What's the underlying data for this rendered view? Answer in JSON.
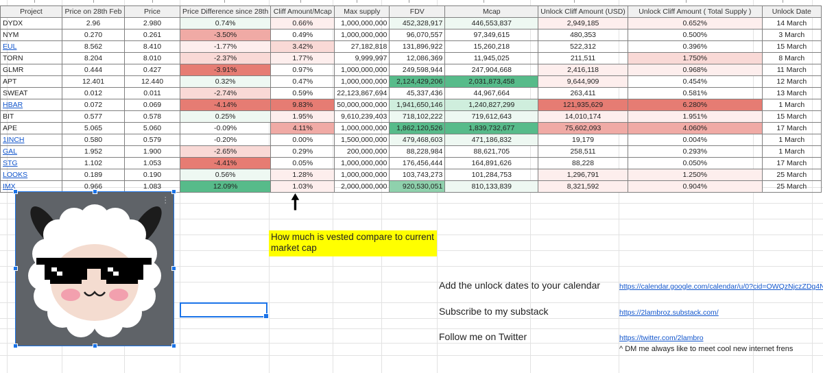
{
  "headers": [
    "Project",
    "Price on 28th Feb",
    "Price",
    "Price Difference since 28th",
    "Cliff Amount/Mcap",
    "Max supply",
    "FDV",
    "Mcap",
    "Unlock Cliff Amount (USD)",
    "Unlock Cliff Amount ( Total Supply )",
    "Unlock Date"
  ],
  "rows": [
    [
      "DYDX",
      "2.96",
      "2.980",
      "0.74%",
      "0.66%",
      "1,000,000,000",
      "452,328,917",
      "446,553,837",
      "2,949,185",
      "0.652%",
      "14 March"
    ],
    [
      "NYM",
      "0.270",
      "0.261",
      "-3.50%",
      "0.49%",
      "1,000,000,000",
      "96,070,557",
      "97,349,615",
      "480,353",
      "0.500%",
      "3 March"
    ],
    [
      "EUL",
      "8.562",
      "8.410",
      "-1.77%",
      "3.42%",
      "27,182,818",
      "131,896,922",
      "15,260,218",
      "522,312",
      "0.396%",
      "15 March"
    ],
    [
      "TORN",
      "8.204",
      "8.010",
      "-2.37%",
      "1.77%",
      "9,999,997",
      "12,086,369",
      "11,945,025",
      "211,511",
      "1.750%",
      "8 March"
    ],
    [
      "GLMR",
      "0.444",
      "0.427",
      "-3.91%",
      "0.97%",
      "1,000,000,000",
      "249,598,944",
      "247,904,668",
      "2,416,118",
      "0.968%",
      "11 March"
    ],
    [
      "APT",
      "12.401",
      "12.440",
      "0.32%",
      "0.47%",
      "1,000,000,000",
      "2,124,429,206",
      "2,031,873,458",
      "9,644,909",
      "0.454%",
      "12 March"
    ],
    [
      "SWEAT",
      "0.012",
      "0.011",
      "-2.74%",
      "0.59%",
      "22,123,867,694",
      "45,337,436",
      "44,967,664",
      "263,411",
      "0.581%",
      "13 March"
    ],
    [
      "HBAR",
      "0.072",
      "0.069",
      "-4.14%",
      "9.83%",
      "50,000,000,000",
      "1,941,650,146",
      "1,240,827,299",
      "121,935,629",
      "6.280%",
      "1 March"
    ],
    [
      "BIT",
      "0.577",
      "0.578",
      "0.25%",
      "1.95%",
      "9,610,239,403",
      "718,102,222",
      "719,612,643",
      "14,010,174",
      "1.951%",
      "15 March"
    ],
    [
      "APE",
      "5.065",
      "5.060",
      "-0.09%",
      "4.11%",
      "1,000,000,000",
      "1,862,120,526",
      "1,839,732,677",
      "75,602,093",
      "4.060%",
      "17 March"
    ],
    [
      "1INCH",
      "0.580",
      "0.579",
      "-0.20%",
      "0.00%",
      "1,500,000,000",
      "479,468,603",
      "471,186,832",
      "19,179",
      "0.004%",
      "1 March"
    ],
    [
      "GAL",
      "1.952",
      "1.900",
      "-2.65%",
      "0.29%",
      "200,000,000",
      "88,228,984",
      "88,621,705",
      "258,511",
      "0.293%",
      "1 March"
    ],
    [
      "STG",
      "1.102",
      "1.053",
      "-4.41%",
      "0.05%",
      "1,000,000,000",
      "176,456,444",
      "164,891,626",
      "88,228",
      "0.050%",
      "17 March"
    ],
    [
      "LOOKS",
      "0.189",
      "0.190",
      "0.56%",
      "1.28%",
      "1,000,000,000",
      "103,743,273",
      "101,284,753",
      "1,296,791",
      "1.250%",
      "25 March"
    ],
    [
      "IMX",
      "0.966",
      "1.083",
      "12.09%",
      "1.03%",
      "2,000,000,000",
      "920,530,051",
      "810,133,839",
      "8,321,592",
      "0.904%",
      "25 March"
    ]
  ],
  "linked_projects": [
    "EUL",
    "HBAR",
    "1INCH",
    "GAL",
    "STG",
    "LOOKS",
    "IMX"
  ],
  "colors": {
    "red_strong": "#e67c73",
    "red_mid": "#f0aaa5",
    "red_light": "#f9d9d6",
    "red_faint": "#fdeeed",
    "green_strong": "#57bb8a",
    "green_mid": "#8fd1ad",
    "green_light": "#cfeedd",
    "green_faint": "#eef8f2",
    "white": "#ffffff"
  },
  "cell_colors": [
    [
      "",
      "",
      "",
      "green_faint",
      "red_faint",
      "",
      "green_faint",
      "green_faint",
      "red_faint",
      "red_faint",
      ""
    ],
    [
      "",
      "",
      "",
      "red_mid",
      "",
      "",
      "",
      "",
      "",
      "",
      ""
    ],
    [
      "",
      "",
      "",
      "red_faint",
      "red_light",
      "",
      "",
      "",
      "",
      "",
      ""
    ],
    [
      "",
      "",
      "",
      "red_light",
      "red_faint",
      "",
      "",
      "",
      "",
      "red_light",
      ""
    ],
    [
      "",
      "",
      "",
      "red_strong",
      "",
      "",
      "",
      "",
      "red_faint",
      "red_faint",
      ""
    ],
    [
      "",
      "",
      "",
      "green_faint",
      "",
      "",
      "green_strong",
      "green_strong",
      "red_faint",
      "",
      ""
    ],
    [
      "",
      "",
      "",
      "red_light",
      "",
      "",
      "",
      "",
      "",
      "",
      ""
    ],
    [
      "",
      "",
      "",
      "red_strong",
      "red_strong",
      "",
      "green_light",
      "green_light",
      "red_strong",
      "red_strong",
      ""
    ],
    [
      "",
      "",
      "",
      "green_faint",
      "red_faint",
      "",
      "green_faint",
      "green_faint",
      "red_faint",
      "red_faint",
      ""
    ],
    [
      "",
      "",
      "",
      "",
      "red_mid",
      "",
      "green_strong",
      "green_strong",
      "red_mid",
      "red_mid",
      ""
    ],
    [
      "",
      "",
      "",
      "",
      "",
      "",
      "green_faint",
      "green_faint",
      "",
      "",
      ""
    ],
    [
      "",
      "",
      "",
      "red_light",
      "",
      "",
      "",
      "",
      "",
      "",
      ""
    ],
    [
      "",
      "",
      "",
      "red_strong",
      "",
      "",
      "",
      "",
      "",
      "",
      ""
    ],
    [
      "",
      "",
      "",
      "green_faint",
      "red_faint",
      "",
      "",
      "",
      "red_faint",
      "red_faint",
      ""
    ],
    [
      "",
      "",
      "",
      "green_strong",
      "red_faint",
      "",
      "green_mid",
      "green_faint",
      "red_faint",
      "red_faint",
      ""
    ]
  ],
  "note": "How much is vested compare to current market cap",
  "promos": [
    {
      "label": "Add the unlock dates to your calendar",
      "link": "https://calendar.google.com/calendar/u/0?cid=OWQzNjczZDg4N"
    },
    {
      "label": "Subscribe to my substack",
      "link": "https://2lambroz.substack.com/"
    },
    {
      "label": "Follow me on Twitter",
      "link": "https://twitter.com/2lambro"
    }
  ],
  "dm_note": "^ DM me always like to meet cool new internet frens",
  "icons": {
    "arrow": "up-arrow-icon",
    "sheep": "sheep-sunglasses-icon",
    "menu": "kebab-menu-icon"
  }
}
